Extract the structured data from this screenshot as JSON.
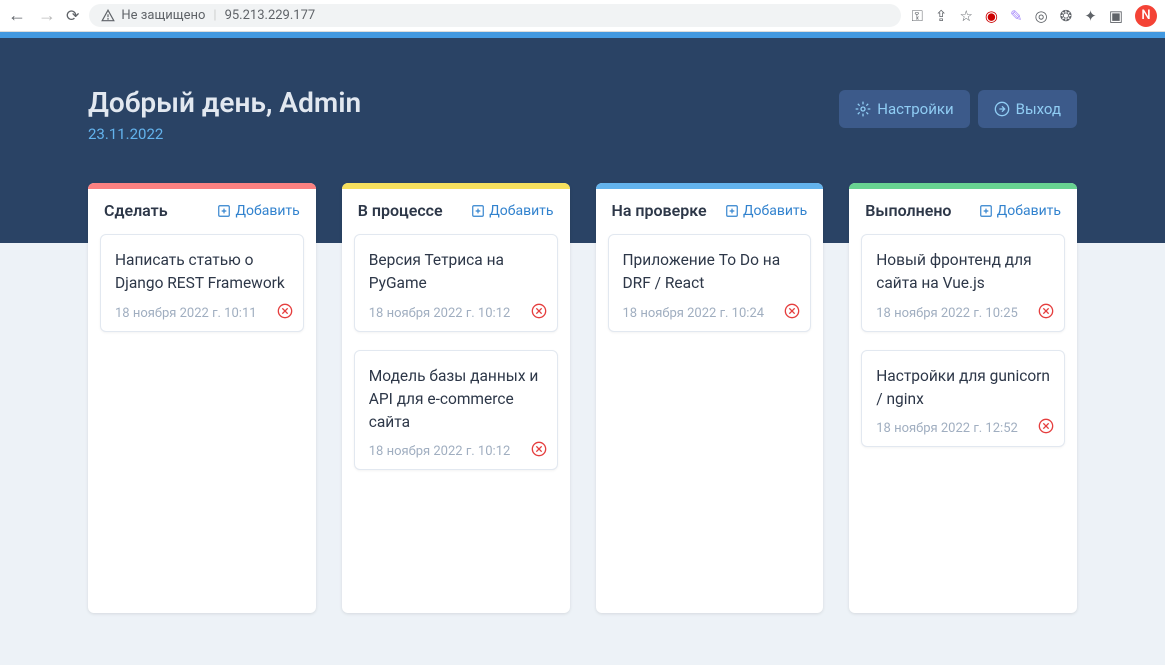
{
  "browser": {
    "security_text": "Не защищено",
    "url": "95.213.229.177",
    "profile_initial": "N"
  },
  "header": {
    "greeting": "Добрый день, Admin",
    "date": "23.11.2022",
    "settings_label": "Настройки",
    "logout_label": "Выход"
  },
  "board": {
    "add_label": "Добавить",
    "columns": [
      {
        "title": "Сделать",
        "accent": "red",
        "cards": [
          {
            "title": "Написать статью о Django REST Framework",
            "date": "18 ноября 2022 г. 10:11"
          }
        ]
      },
      {
        "title": "В процессе",
        "accent": "yellow",
        "cards": [
          {
            "title": "Версия Тетриса на PyGame",
            "date": "18 ноября 2022 г. 10:12"
          },
          {
            "title": "Модель базы данных и API для e-commerce сайта",
            "date": "18 ноября 2022 г. 10:12"
          }
        ]
      },
      {
        "title": "На проверке",
        "accent": "blue",
        "cards": [
          {
            "title": "Приложение To Do на DRF / React",
            "date": "18 ноября 2022 г. 10:24"
          }
        ]
      },
      {
        "title": "Выполнено",
        "accent": "green",
        "cards": [
          {
            "title": "Новый фронтенд для сайта на Vue.js",
            "date": "18 ноября 2022 г. 10:25"
          },
          {
            "title": "Настройки для gunicorn / nginx",
            "date": "18 ноября 2022 г. 12:52"
          }
        ]
      }
    ]
  }
}
